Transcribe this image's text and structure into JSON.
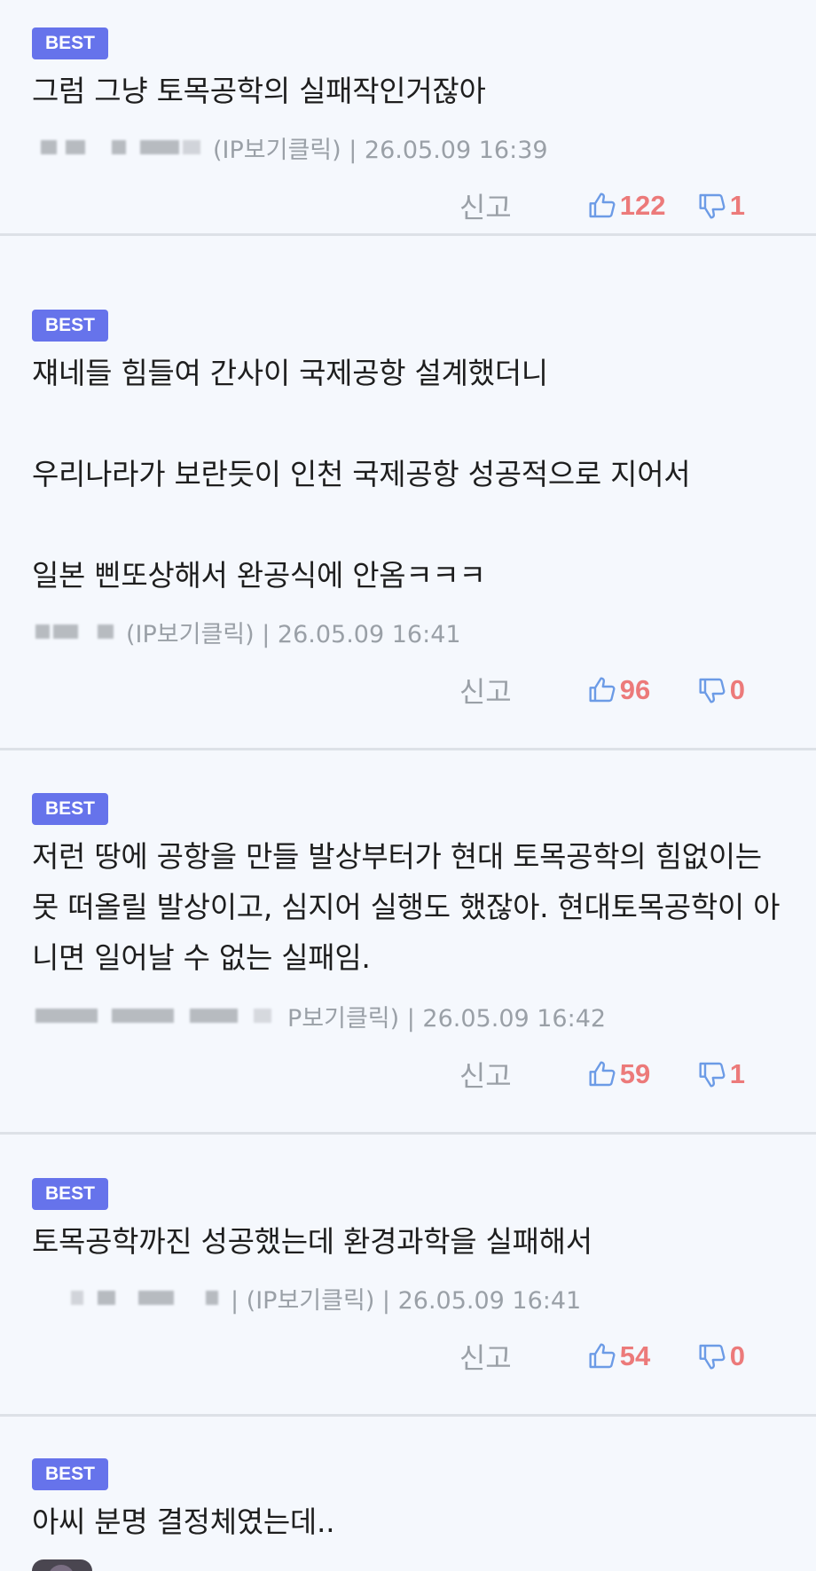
{
  "comments": [
    {
      "badge": "BEST",
      "text": "그럼 그냥 토목공학의 실패작인거잖아",
      "meta": "(IP보기클릭) | 26.05.09 16:39",
      "report": "신고",
      "up": "122",
      "down": "1"
    },
    {
      "badge": "BEST",
      "text": "쟤네들 힘들여 간사이 국제공항 설계했더니\n\n우리나라가 보란듯이 인천 국제공항 성공적으로 지어서\n\n일본 삔또상해서 완공식에 안옴ㅋㅋㅋ",
      "meta": "(IP보기클릭) | 26.05.09 16:41",
      "report": "신고",
      "up": "96",
      "down": "0"
    },
    {
      "badge": "BEST",
      "text": "저런 땅에 공항을 만들 발상부터가 현대 토목공학의 힘없이는 못 떠올릴 발상이고, 심지어 실행도 했잖아. 현대토목공학이 아니면 일어날 수 없는 실패임.",
      "meta": "P보기클릭) | 26.05.09 16:42",
      "report": "신고",
      "up": "59",
      "down": "1"
    },
    {
      "badge": "BEST",
      "text": "토목공학까진 성공했는데 환경과학을 실패해서",
      "meta": "| (IP보기클릭) | 26.05.09 16:41",
      "report": "신고",
      "up": "54",
      "down": "0"
    },
    {
      "badge": "BEST",
      "text": "아씨 분명 결정체였는데.."
    }
  ],
  "icons": {
    "thumbs_up": "thumbs-up-icon",
    "thumbs_down": "thumbs-down-icon"
  },
  "colors": {
    "background": "#f5f8fd",
    "badge": "#6673eb",
    "vote_count": "#ec7a7a",
    "icon": "#6c9be6",
    "meta_text": "#9aa0a7",
    "divider": "#dde1e7"
  }
}
